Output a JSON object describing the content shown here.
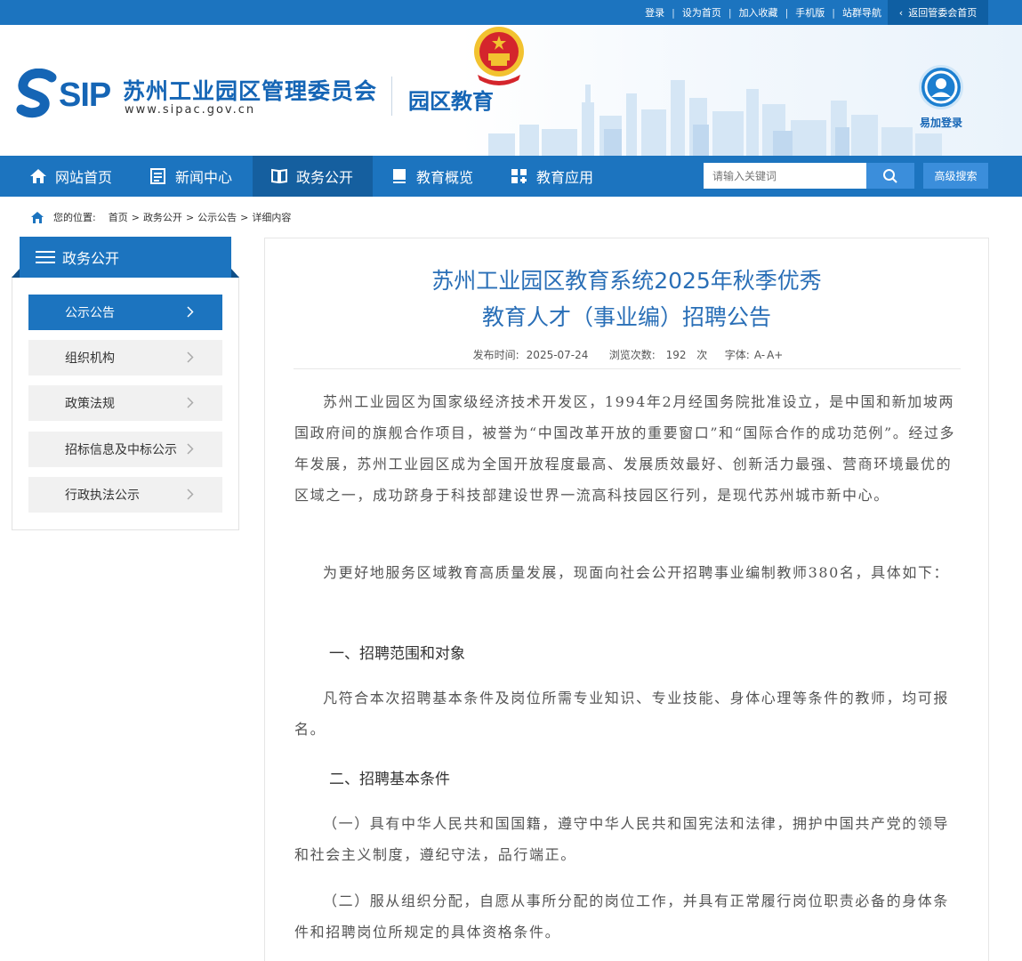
{
  "topbar": {
    "links": [
      "登录",
      "设为首页",
      "加入收藏",
      "手机版",
      "站群导航"
    ],
    "back_label": "返回管委会首页"
  },
  "header": {
    "logo_text": "SIP",
    "org_name": "苏州工业园区管理委员会",
    "org_url": "www.sipac.gov.cn",
    "section_name": "园区教育",
    "login_label": "易加登录"
  },
  "nav": {
    "items": [
      "网站首页",
      "新闻中心",
      "政务公开",
      "教育概览",
      "教育应用"
    ],
    "search_placeholder": "请输入关键词",
    "advanced_search_label": "高级搜索"
  },
  "breadcrumb": {
    "label": "您的位置:",
    "items": [
      "首页",
      "政务公开",
      "公示公告",
      "详细内容"
    ]
  },
  "sidebar": {
    "title": "政务公开",
    "items": [
      "公示公告",
      "组织机构",
      "政策法规",
      "招标信息及中标公示",
      "行政执法公示"
    ]
  },
  "article": {
    "title_line1": "苏州工业园区教育系统2025年秋季优秀",
    "title_line2": "教育人才（事业编）招聘公告",
    "meta": {
      "publish_label": "发布时间:",
      "publish_date": "2025-07-24",
      "views_label": "浏览次数:",
      "views": "192",
      "views_unit": "次",
      "font_label": "字体:",
      "font_smaller": "A-",
      "font_larger": "A+"
    },
    "para1": "苏州工业园区为国家级经济技术开发区，1994年2月经国务院批准设立，是中国和新加坡两国政府间的旗舰合作项目，被誉为“中国改革开放的重要窗口”和“国际合作的成功范例”。经过多年发展，苏州工业园区成为全国开放程度最高、发展质效最好、创新活力最强、营商环境最优的区域之一，成功跻身于科技部建设世界一流高科技园区行列，是现代苏州城市新中心。",
    "para2": "为更好地服务区域教育高质量发展，现面向社会公开招聘事业编制教师380名，具体如下：",
    "heading1": "一、招聘范围和对象",
    "para3": "凡符合本次招聘基本条件及岗位所需专业知识、专业技能、身体心理等条件的教师，均可报名。",
    "heading2": "二、招聘基本条件",
    "para4": "（一）具有中华人民共和国国籍，遵守中华人民共和国宪法和法律，拥护中国共产党的领导和社会主义制度，遵纪守法，品行端正。",
    "para5": "（二）服从组织分配，自愿从事所分配的岗位工作，并具有正常履行岗位职责必备的身体条件和招聘岗位所规定的具体资格条件。"
  },
  "colors": {
    "brand_blue": "#1c74bf",
    "title_blue": "#2a6fb7"
  }
}
